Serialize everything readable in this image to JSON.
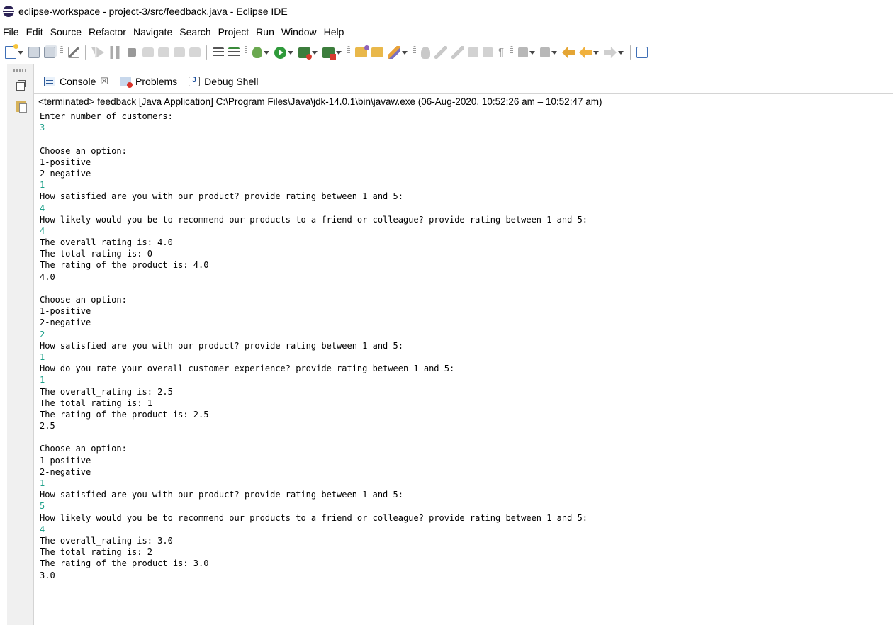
{
  "window": {
    "title": "eclipse-workspace - project-3/src/feedback.java - Eclipse IDE"
  },
  "menu": [
    "File",
    "Edit",
    "Source",
    "Refactor",
    "Navigate",
    "Search",
    "Project",
    "Run",
    "Window",
    "Help"
  ],
  "toolbar_icons": [
    "new-icon",
    "save-icon",
    "save-all-icon",
    "skip-breakpoints-icon",
    "resume-icon",
    "suspend-icon",
    "terminate-icon",
    "disconnect-icon",
    "step-into-icon",
    "step-over-icon",
    "step-return-icon",
    "drop-to-frame-icon",
    "use-step-filters-icon",
    "debug-icon",
    "run-icon",
    "coverage-icon",
    "external-tools-icon",
    "new-java-project-icon",
    "open-type-icon",
    "search-icon",
    "annotation-icon",
    "highlight-icon",
    "toggle-mark-icon",
    "show-whitespace-icon",
    "pilcrow-icon",
    "next-annotation-icon",
    "previous-annotation-icon",
    "last-edit-icon",
    "back-icon",
    "forward-icon",
    "open-perspective-icon"
  ],
  "tabs": [
    {
      "label": "Console",
      "icon": "console-icon",
      "active": true,
      "close": "☒"
    },
    {
      "label": "Problems",
      "icon": "problems-icon",
      "active": false
    },
    {
      "label": "Debug Shell",
      "icon": "debug-shell-icon",
      "active": false
    }
  ],
  "console": {
    "status": "<terminated> feedback [Java Application] C:\\Program Files\\Java\\jdk-14.0.1\\bin\\javaw.exe  (06-Aug-2020, 10:52:26 am – 10:52:47 am)",
    "lines": [
      {
        "text": "Enter number of customers:",
        "type": "out"
      },
      {
        "text": "3",
        "type": "in"
      },
      {
        "text": "",
        "type": "out"
      },
      {
        "text": "Choose an option:",
        "type": "out"
      },
      {
        "text": "1-positive",
        "type": "out"
      },
      {
        "text": "2-negative",
        "type": "out"
      },
      {
        "text": "1",
        "type": "in"
      },
      {
        "text": "How satisfied are you with our product? provide rating between 1 and 5:",
        "type": "out"
      },
      {
        "text": "4",
        "type": "in"
      },
      {
        "text": "How likely would you be to recommend our products to a friend or colleague? provide rating between 1 and 5:",
        "type": "out"
      },
      {
        "text": "4",
        "type": "in"
      },
      {
        "text": "The overall_rating is: 4.0",
        "type": "out"
      },
      {
        "text": "The total rating is: 0",
        "type": "out"
      },
      {
        "text": "The rating of the product is: 4.0",
        "type": "out"
      },
      {
        "text": "4.0",
        "type": "out"
      },
      {
        "text": "",
        "type": "out"
      },
      {
        "text": "Choose an option:",
        "type": "out"
      },
      {
        "text": "1-positive",
        "type": "out"
      },
      {
        "text": "2-negative",
        "type": "out"
      },
      {
        "text": "2",
        "type": "in"
      },
      {
        "text": "How satisfied are you with our product? provide rating between 1 and 5:",
        "type": "out"
      },
      {
        "text": "1",
        "type": "in"
      },
      {
        "text": "How do you rate your overall customer experience? provide rating between 1 and 5:",
        "type": "out"
      },
      {
        "text": "1",
        "type": "in"
      },
      {
        "text": "The overall_rating is: 2.5",
        "type": "out"
      },
      {
        "text": "The total rating is: 1",
        "type": "out"
      },
      {
        "text": "The rating of the product is: 2.5",
        "type": "out"
      },
      {
        "text": "2.5",
        "type": "out"
      },
      {
        "text": "",
        "type": "out"
      },
      {
        "text": "Choose an option:",
        "type": "out"
      },
      {
        "text": "1-positive",
        "type": "out"
      },
      {
        "text": "2-negative",
        "type": "out"
      },
      {
        "text": "1",
        "type": "in"
      },
      {
        "text": "How satisfied are you with our product? provide rating between 1 and 5:",
        "type": "out"
      },
      {
        "text": "5",
        "type": "in"
      },
      {
        "text": "How likely would you be to recommend our products to a friend or colleague? provide rating between 1 and 5:",
        "type": "out"
      },
      {
        "text": "4",
        "type": "in"
      },
      {
        "text": "The overall_rating is: 3.0",
        "type": "out"
      },
      {
        "text": "The total rating is: 2",
        "type": "out"
      },
      {
        "text": "The rating of the product is: 3.0",
        "type": "out"
      },
      {
        "text": "3.0",
        "type": "out"
      }
    ]
  },
  "colors": {
    "input_text": "#1fa08a",
    "output_text": "#000000",
    "tab_icon_blue": "#2e5b9a"
  }
}
